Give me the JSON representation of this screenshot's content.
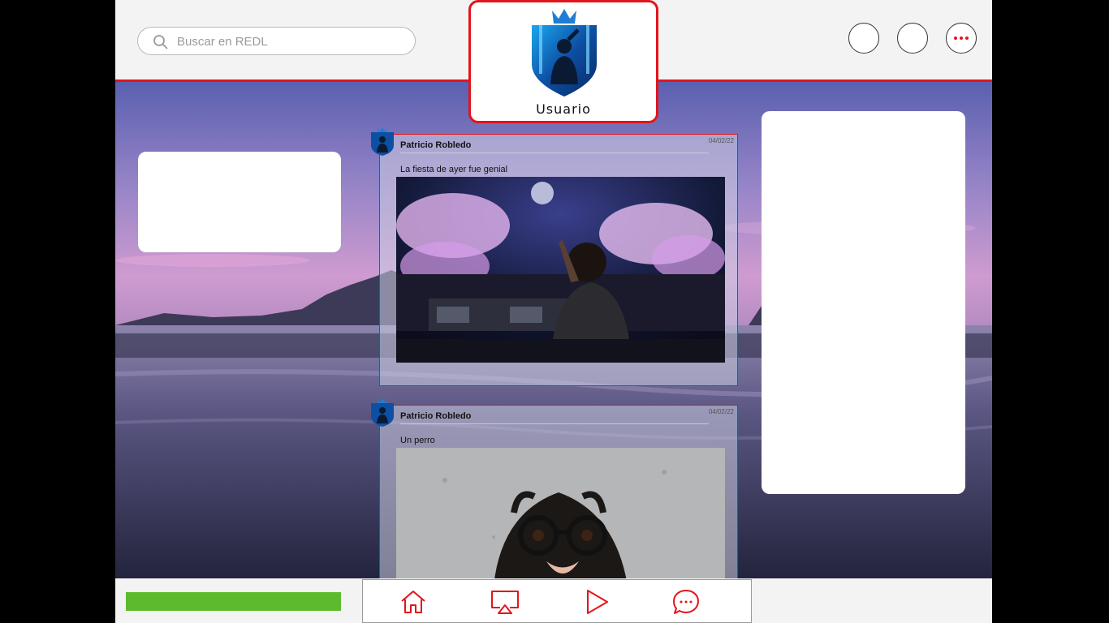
{
  "search": {
    "placeholder": "Buscar en REDL"
  },
  "header": {
    "profile_name": "Usuario",
    "actions": [
      {
        "name": "circle-button-1",
        "icon": "blank-circle"
      },
      {
        "name": "circle-button-2",
        "icon": "blank-circle"
      },
      {
        "name": "more-button",
        "icon": "more-dots-icon"
      }
    ]
  },
  "posts": [
    {
      "author": "Patricio Robledo",
      "date": "04/02/22",
      "text": "La fiesta de ayer fue genial",
      "media": "party-dj-photo"
    },
    {
      "author": "Patricio Robledo",
      "date": "04/02/22",
      "text": "Un perro",
      "media": "dog-with-glasses-photo"
    }
  ],
  "progress": {
    "value": 1.0
  },
  "nav": [
    {
      "name": "nav-home",
      "icon": "home-icon"
    },
    {
      "name": "nav-cast",
      "icon": "cast-icon"
    },
    {
      "name": "nav-play",
      "icon": "play-icon"
    },
    {
      "name": "nav-chat",
      "icon": "chat-icon"
    }
  ],
  "colors": {
    "accent": "#e3141b",
    "progress": "#5dba2f",
    "topbar": "#f3f3f3"
  }
}
